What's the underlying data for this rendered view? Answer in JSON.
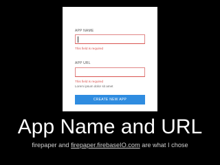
{
  "form": {
    "app_name_label": "App Name",
    "app_name_value": "",
    "app_name_error": "This field is required",
    "app_url_label": "App URL",
    "app_url_value": "",
    "app_url_error": "This field is required",
    "app_url_hint": "Lorem ipsum dolor sit amet",
    "create_button_label": "Create New App"
  },
  "slide": {
    "title": "App Name and URL",
    "subtitle_before": "firepaper and ",
    "subtitle_link": "firepaper.firebaseIO.com",
    "subtitle_after": " are what I chose"
  },
  "colors": {
    "error": "#d9534f",
    "button": "#2f8ce0",
    "background": "#000000"
  }
}
